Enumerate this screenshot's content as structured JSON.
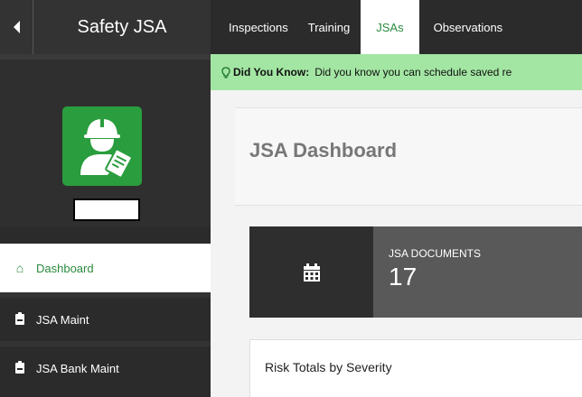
{
  "sidebar": {
    "title": "Safety JSA",
    "nav": [
      {
        "label": "Dashboard",
        "icon": "home-icon",
        "active": true
      },
      {
        "label": "JSA Maint",
        "icon": "clipboard-icon"
      },
      {
        "label": "JSA Bank Maint",
        "icon": "clipboard-icon"
      }
    ]
  },
  "topnav": {
    "tabs": [
      {
        "label": "Inspections"
      },
      {
        "label": "Training"
      },
      {
        "label": "JSAs",
        "active": true
      },
      {
        "label": "Observations"
      }
    ]
  },
  "banner": {
    "label": "Did You Know:",
    "text": "Did you know you can schedule saved re"
  },
  "main": {
    "title": "JSA Dashboard",
    "stat": {
      "label": "JSA DOCUMENTS",
      "value": "17",
      "icon": "calendar-icon"
    },
    "risk_panel_title": "Risk Totals by Severity"
  },
  "colors": {
    "accent": "#2a8a3e",
    "banner_bg": "#a3e6a3",
    "sidebar_bg": "#2b2b2b"
  }
}
